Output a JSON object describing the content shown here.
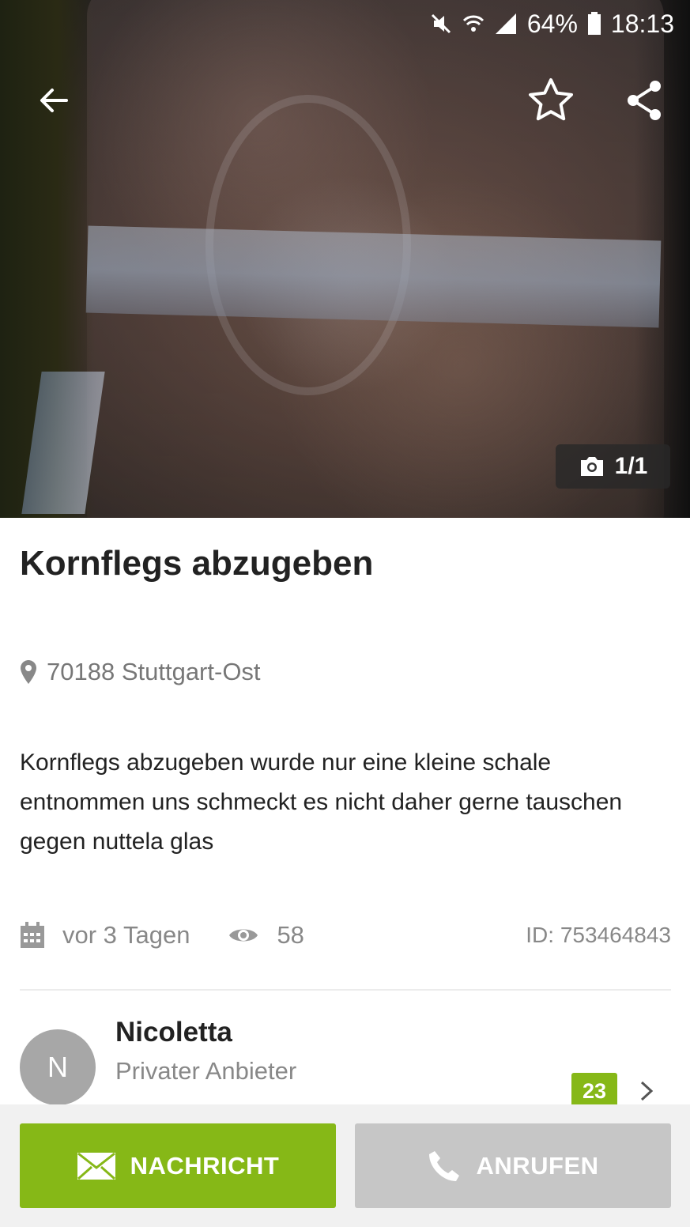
{
  "status_bar": {
    "battery": "64%",
    "time": "18:13"
  },
  "gallery": {
    "counter": "1/1"
  },
  "listing": {
    "title": "Kornflegs abzugeben",
    "location": "70188 Stuttgart-Ost",
    "description": "Kornflegs abzugeben wurde nur eine kleine schale entnommen uns schmeckt es nicht daher gerne tauschen gegen nuttela glas",
    "posted": "vor 3 Tagen",
    "views": "58",
    "id": "ID: 753464843"
  },
  "seller": {
    "initial": "N",
    "name": "Nicoletta",
    "type": "Privater Anbieter",
    "rating_count": "23"
  },
  "actions": {
    "message_label": "NACHRICHT",
    "call_label": "ANRUFEN"
  },
  "colors": {
    "accent": "#86b817",
    "disabled": "#c6c6c6"
  }
}
